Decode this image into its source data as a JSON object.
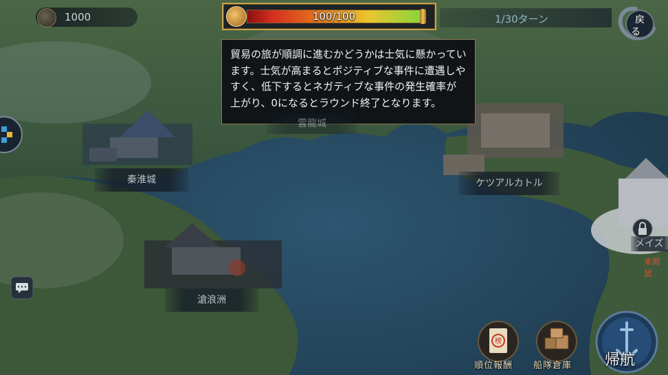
{
  "hud": {
    "currency_icon": "coin-icon",
    "currency_value": "1000",
    "morale_icon": "helmet-icon",
    "morale_text": "100/100",
    "morale_fraction": 1.0,
    "turn_text": "1/30ターン",
    "back_label": "戻る"
  },
  "tooltip": {
    "text": "貿易の旅が順調に進むかどうかは士気に懸かっています。士気が高まるとポジティブな事件に遭遇しやすく、低下するとネガティブな事件の発生確率が上がり、0になるとラウンド終了となります。"
  },
  "cities": {
    "qinhuai": "秦淮城",
    "yunlong": "雲龍城",
    "quetzalcoatl": "ケツアルカトル",
    "cangliang": "滄浪洲",
    "maze": "メイズ部",
    "maze_status": "未開放"
  },
  "buttons": {
    "ranking_reward": "順位報酬",
    "fleet_storage": "船隊倉庫",
    "return_voyage": "帰航",
    "ranking_symbol": "榜"
  },
  "colors": {
    "ocean": "#274b62",
    "land": "#3f5a3a",
    "gold_frame": "#c8a24a",
    "unopened_red": "#e04a2e"
  }
}
